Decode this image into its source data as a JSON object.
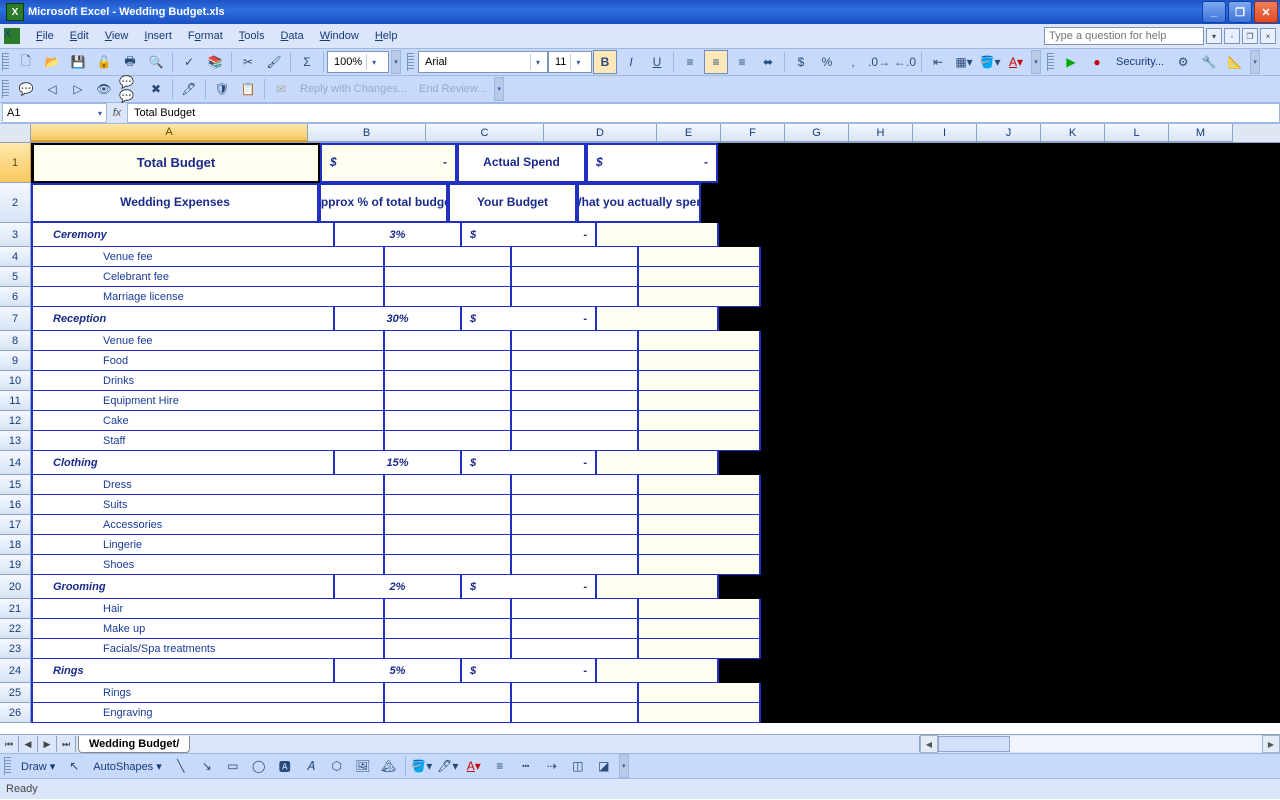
{
  "titlebar": {
    "app": "Microsoft Excel",
    "doc": "Wedding Budget.xls"
  },
  "menus": [
    "File",
    "Edit",
    "View",
    "Insert",
    "Format",
    "Tools",
    "Data",
    "Window",
    "Help"
  ],
  "questionPlaceholder": "Type a question for help",
  "toolbars": {
    "zoom": "100%",
    "font": "Arial",
    "size": "11"
  },
  "reviewing": {
    "reply": "Reply with Changes...",
    "end": "End Review..."
  },
  "security": "Security...",
  "namebox": "A1",
  "formula": "Total Budget",
  "columns": [
    "A",
    "B",
    "C",
    "D",
    "E",
    "F",
    "G",
    "H",
    "I",
    "J",
    "K",
    "L",
    "M"
  ],
  "rowHeaders": [
    "1",
    "2",
    "3",
    "4",
    "5",
    "6",
    "7",
    "8",
    "9",
    "10",
    "11",
    "12",
    "13",
    "14",
    "15",
    "16",
    "17",
    "18",
    "19",
    "20",
    "21",
    "22",
    "23",
    "24",
    "25",
    "26"
  ],
  "hdr1": {
    "A": "Total Budget",
    "B_l": "$",
    "B_r": "-",
    "C": "Actual Spend",
    "D_l": "$",
    "D_r": "-"
  },
  "hdr2": {
    "A": "Wedding Expenses",
    "B": "Approx % of total budget",
    "C": "Your Budget",
    "D": "What you actually spent"
  },
  "rows": [
    {
      "type": "cat",
      "a": "Ceremony",
      "b": "3%",
      "c_l": "$",
      "c_r": "-"
    },
    {
      "type": "sub",
      "a": "Venue fee"
    },
    {
      "type": "sub",
      "a": "Celebrant fee"
    },
    {
      "type": "sub",
      "a": "Marriage license"
    },
    {
      "type": "cat",
      "a": "Reception",
      "b": "30%",
      "c_l": "$",
      "c_r": "-"
    },
    {
      "type": "sub",
      "a": "Venue fee"
    },
    {
      "type": "sub",
      "a": "Food"
    },
    {
      "type": "sub",
      "a": "Drinks"
    },
    {
      "type": "sub",
      "a": "Equipment Hire"
    },
    {
      "type": "sub",
      "a": "Cake"
    },
    {
      "type": "sub",
      "a": "Staff"
    },
    {
      "type": "cat",
      "a": "Clothing",
      "b": "15%",
      "c_l": "$",
      "c_r": "-"
    },
    {
      "type": "sub",
      "a": "Dress"
    },
    {
      "type": "sub",
      "a": "Suits"
    },
    {
      "type": "sub",
      "a": "Accessories"
    },
    {
      "type": "sub",
      "a": "Lingerie"
    },
    {
      "type": "sub",
      "a": "Shoes"
    },
    {
      "type": "cat",
      "a": "Grooming",
      "b": "2%",
      "c_l": "$",
      "c_r": "-"
    },
    {
      "type": "sub",
      "a": "Hair"
    },
    {
      "type": "sub",
      "a": "Make up"
    },
    {
      "type": "sub",
      "a": "Facials/Spa treatments"
    },
    {
      "type": "cat",
      "a": "Rings",
      "b": "5%",
      "c_l": "$",
      "c_r": "-"
    },
    {
      "type": "sub",
      "a": "Rings"
    },
    {
      "type": "sub",
      "a": "Engraving"
    }
  ],
  "sheetTab": "Wedding Budget",
  "draw": {
    "label": "Draw",
    "autoshapes": "AutoShapes"
  },
  "status": "Ready"
}
